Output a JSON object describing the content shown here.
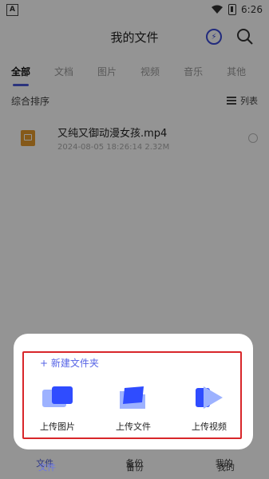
{
  "status_bar": {
    "time": "6:26",
    "left_badge": "A"
  },
  "header": {
    "title": "我的文件"
  },
  "tabs": [
    {
      "label": "全部",
      "active": true
    },
    {
      "label": "文档",
      "active": false
    },
    {
      "label": "图片",
      "active": false
    },
    {
      "label": "视频",
      "active": false
    },
    {
      "label": "音乐",
      "active": false
    },
    {
      "label": "其他",
      "active": false
    }
  ],
  "sortbar": {
    "sort_label": "综合排序",
    "view_label": "列表"
  },
  "file": {
    "name": "又纯又御动漫女孩.mp4",
    "meta": "2024-08-05 18:26:14 2.32M"
  },
  "sheet": {
    "new_folder_label": "+ 新建文件夹",
    "actions": [
      {
        "label": "上传图片",
        "icon": "upload-image-icon"
      },
      {
        "label": "上传文件",
        "icon": "upload-file-icon"
      },
      {
        "label": "上传视频",
        "icon": "upload-video-icon"
      }
    ]
  },
  "bottom_nav": {
    "items": [
      {
        "label": "文件",
        "icon": "folder-icon",
        "active": true
      },
      {
        "label": "备份",
        "icon": "backup-icon",
        "active": false
      },
      {
        "label": "我的",
        "icon": "profile-icon",
        "active": false
      }
    ]
  },
  "colors": {
    "accent": "#4a5ad8",
    "highlight": "#d8262a",
    "file_icon": "#e59a2c"
  }
}
